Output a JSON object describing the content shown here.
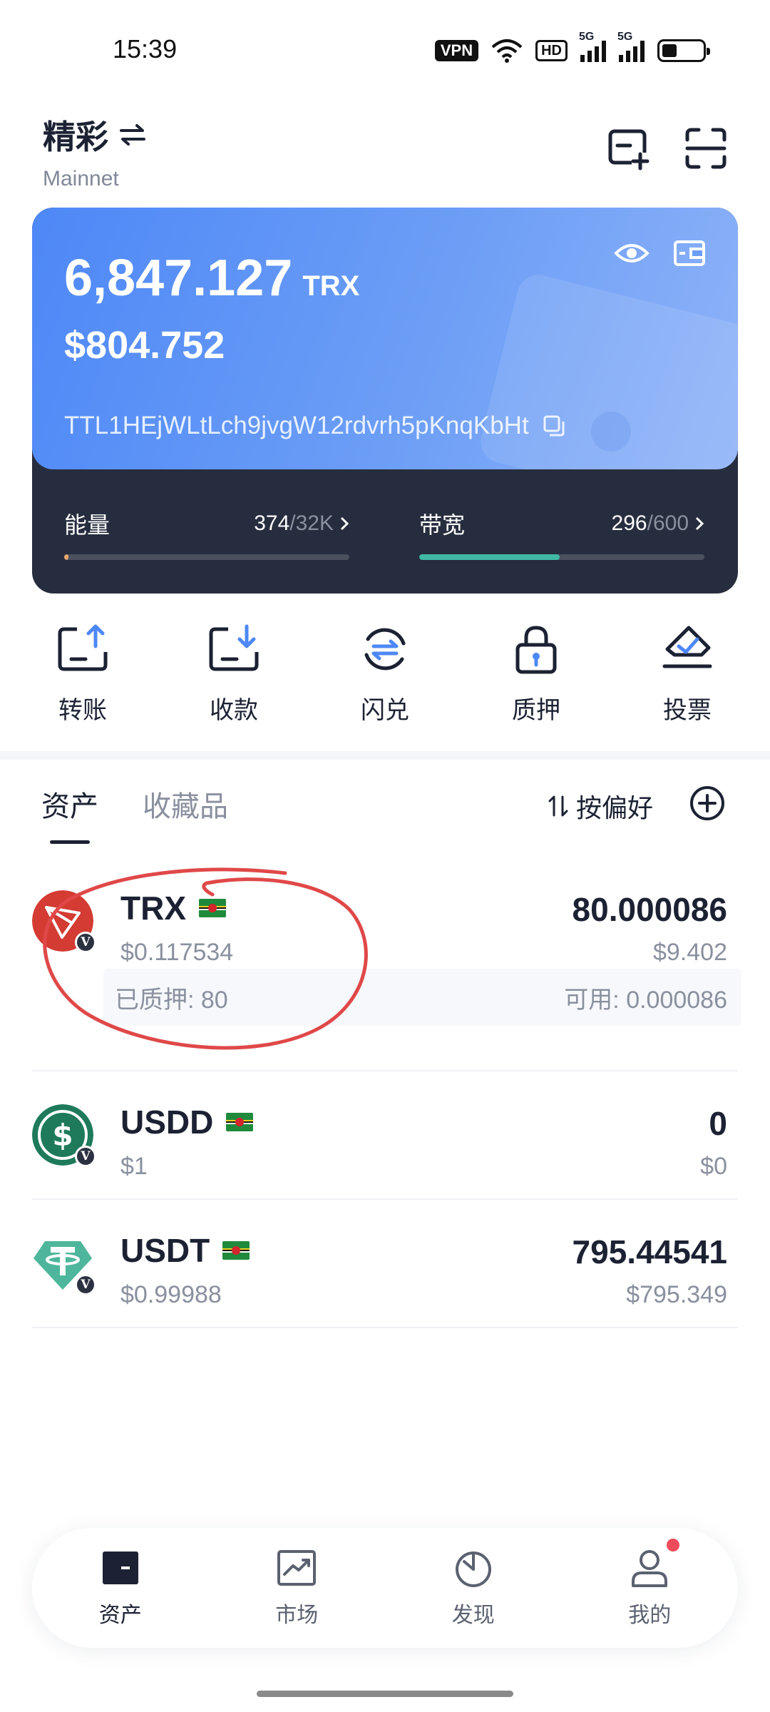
{
  "status": {
    "time": "15:39",
    "vpn": "VPN",
    "hd": "HD",
    "sig1": "5G",
    "sig2": "5G"
  },
  "header": {
    "wallet_name": "精彩",
    "network": "Mainnet"
  },
  "card": {
    "balance": "6,847.127",
    "unit": "TRX",
    "usd": "$804.752",
    "address": "TTL1HEjWLtLch9jvgW12rdvrh5pKnqKbHt",
    "energy": {
      "label": "能量",
      "used": "374",
      "total": "/32K",
      "fill": 0.012
    },
    "bandwidth": {
      "label": "带宽",
      "used": "296",
      "total": "/600",
      "fill": 0.493
    }
  },
  "actions": [
    {
      "label": "转账",
      "icon": "send-icon"
    },
    {
      "label": "收款",
      "icon": "receive-icon"
    },
    {
      "label": "闪兑",
      "icon": "swap-icon"
    },
    {
      "label": "质押",
      "icon": "lock-icon"
    },
    {
      "label": "投票",
      "icon": "vote-icon"
    }
  ],
  "tabs": {
    "assets": "资产",
    "collectibles": "收藏品",
    "sort": "按偏好"
  },
  "assets": [
    {
      "symbol": "TRX",
      "price": "$0.117534",
      "amount": "80.000086",
      "value": "$9.402",
      "staked": "已质押: 80",
      "available": "可用: 0.000086"
    },
    {
      "symbol": "USDD",
      "price": "$1",
      "amount": "0",
      "value": "$0"
    },
    {
      "symbol": "USDT",
      "price": "$0.99988",
      "amount": "795.44541",
      "value": "$795.349"
    }
  ],
  "badge": "V",
  "nav": [
    {
      "label": "资产",
      "icon": "wallet-icon"
    },
    {
      "label": "市场",
      "icon": "chart-icon"
    },
    {
      "label": "发现",
      "icon": "discover-icon"
    },
    {
      "label": "我的",
      "icon": "profile-icon"
    }
  ],
  "colors": {
    "accent": "#4e88f7",
    "dark": "#262d3e",
    "bandwidth": "#3fb8a5",
    "energy": "#e8a56a",
    "trx": "#d33b33",
    "usdd": "#1e7a5b",
    "usdt": "#4eb69c",
    "annotation": "#e04848"
  }
}
